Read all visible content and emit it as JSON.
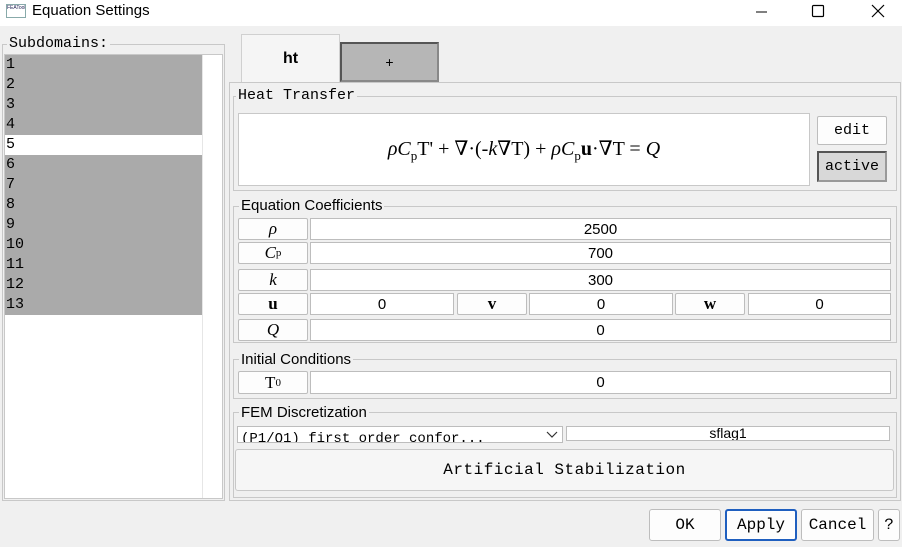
{
  "window": {
    "title": "Equation Settings",
    "app_icon_text": "FEATool"
  },
  "subdomains": {
    "label": "Subdomains:",
    "items": [
      "1",
      "2",
      "3",
      "4",
      "5",
      "6",
      "7",
      "8",
      "9",
      "10",
      "11",
      "12",
      "13"
    ],
    "selected": "5"
  },
  "tabs": [
    {
      "label": "ht",
      "active": true
    },
    {
      "label": "+",
      "active": false
    }
  ],
  "heat_transfer": {
    "label": "Heat Transfer",
    "edit_label": "edit",
    "active_label": "active"
  },
  "coefficients": {
    "label": "Equation Coefficients",
    "rho": {
      "symbol": "ρ",
      "value": "2500"
    },
    "cp": {
      "symbol": "C",
      "sub": "p",
      "value": "700"
    },
    "k": {
      "symbol": "k",
      "value": "300"
    },
    "u": {
      "symbol": "u",
      "value": "0"
    },
    "v": {
      "symbol": "v",
      "value": "0"
    },
    "w": {
      "symbol": "w",
      "value": "0"
    },
    "q": {
      "symbol": "Q",
      "value": "0"
    }
  },
  "initial_conditions": {
    "label": "Initial Conditions",
    "t0": {
      "symbol": "T",
      "sub": "0",
      "value": "0"
    }
  },
  "fem": {
    "label": "FEM Discretization",
    "selected": "(P1/Q1) first order confor...",
    "sflag": "sflag1",
    "stabilization_label": "Artificial Stabilization"
  },
  "buttons": {
    "ok": "OK",
    "apply": "Apply",
    "cancel": "Cancel",
    "help": "?"
  }
}
